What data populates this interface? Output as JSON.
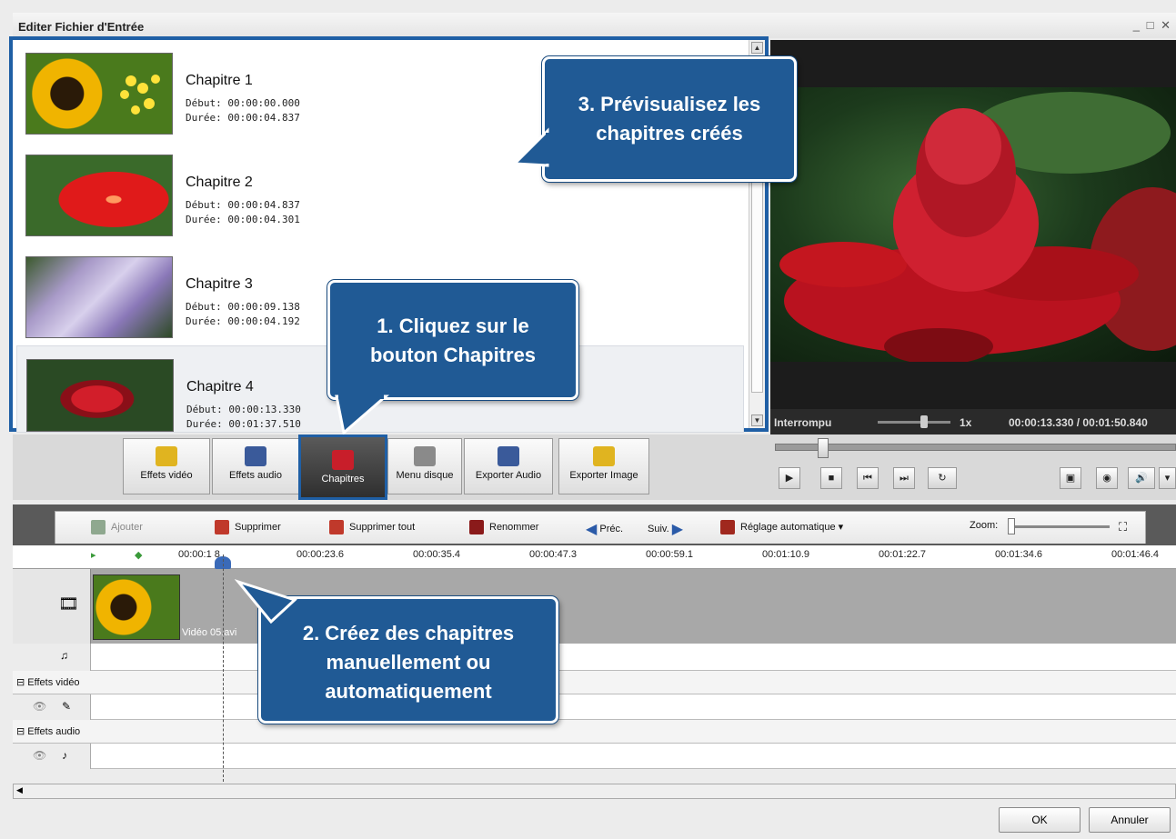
{
  "window": {
    "title": "Editer Fichier d'Entrée",
    "controls": "_ □ ✕"
  },
  "chapters": [
    {
      "name": "Chapitre 1",
      "debut_label": "Début:",
      "debut": "00:00:00.000",
      "duree_label": "Durée:",
      "duree": "00:00:04.837",
      "thumb": "sunflower"
    },
    {
      "name": "Chapitre 2",
      "debut_label": "Début:",
      "debut": "00:00:04.837",
      "duree_label": "Durée:",
      "duree": "00:00:04.301",
      "thumb": "hibiscus"
    },
    {
      "name": "Chapitre 3",
      "debut_label": "Début:",
      "debut": "00:00:09.138",
      "duree_label": "Durée:",
      "duree": "00:00:04.192",
      "thumb": "foxglove"
    },
    {
      "name": "Chapitre 4",
      "debut_label": "Début:",
      "debut": "00:00:13.330",
      "duree_label": "Durée:",
      "duree": "00:01:37.510",
      "thumb": "red-ginger"
    }
  ],
  "player": {
    "status": "Interrompu",
    "speed": "1x",
    "time": "00:00:13.330 / 00:01:50.840"
  },
  "toolbar": {
    "effets_video": "Effets vidéo",
    "effets_audio": "Effets audio",
    "chapitres": "Chapitres",
    "menu_disque": "Menu disque",
    "exporter_audio": "Exporter Audio",
    "exporter_image": "Exporter Image"
  },
  "timeline_toolbar": {
    "ajouter": "Ajouter",
    "supprimer": "Supprimer",
    "supprimer_tout": "Supprimer tout",
    "renommer": "Renommer",
    "prec": "Préc.",
    "suiv": "Suiv.",
    "reglage": "Réglage automatique",
    "zoom": "Zoom:"
  },
  "ruler": {
    "first": "00:00:1  8",
    "ticks": [
      "00:00:23.6",
      "00:00:35.4",
      "00:00:47.3",
      "00:00:59.1",
      "00:01:10.9",
      "00:01:22.7",
      "00:01:34.6",
      "00:01:46.4"
    ]
  },
  "tracks": {
    "clip_label": "Vidéo 05.avi",
    "group_video": "⊟ Effets vidéo",
    "group_audio": "⊟ Effets audio"
  },
  "footer": {
    "ok": "OK",
    "annuler": "Annuler"
  },
  "callouts": {
    "c1": [
      "1. Cliquez sur le",
      "bouton Chapitres"
    ],
    "c2": [
      "2. Créez des chapitres",
      "manuellement ou",
      "automatiquement"
    ],
    "c3": [
      "3. Prévisualisez les",
      "chapitres créés"
    ]
  },
  "colors": {
    "accent": "#1f5fa5",
    "callout": "#205a95"
  }
}
